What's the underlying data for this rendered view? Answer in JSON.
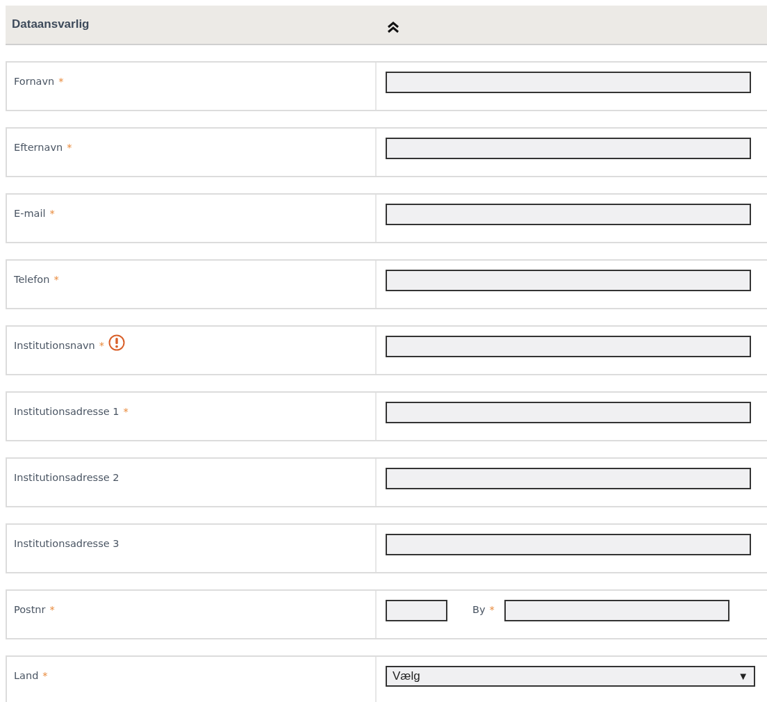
{
  "section": {
    "title": "Dataansvarlig",
    "expanded": true
  },
  "rows": [
    {
      "label": "Fornavn",
      "required_mark": "*",
      "kind": "text",
      "warning": false
    },
    {
      "label": "Efternavn",
      "required_mark": "*",
      "kind": "text",
      "warning": false
    },
    {
      "label": "E-mail",
      "required_mark": "*",
      "kind": "text",
      "warning": false
    },
    {
      "label": "Telefon",
      "required_mark": "*",
      "kind": "text",
      "warning": false
    },
    {
      "label": "Institutionsnavn",
      "required_mark": "*",
      "kind": "text",
      "warning": true
    },
    {
      "label": "Institutionsadresse 1",
      "required_mark": "*",
      "kind": "text",
      "warning": false
    },
    {
      "label": "Institutionsadresse 2",
      "kind": "text",
      "warning": false
    },
    {
      "label": "Institutionsadresse 3",
      "kind": "text",
      "warning": false
    },
    {
      "label": "Postnr",
      "required_mark": "*",
      "kind": "postal_city",
      "city_label": "By",
      "city_required_mark": "*",
      "warning": false
    },
    {
      "label": "Land",
      "required_mark": "*",
      "kind": "select",
      "value": "Vælg",
      "arrow": "▼",
      "warning": false
    }
  ]
}
